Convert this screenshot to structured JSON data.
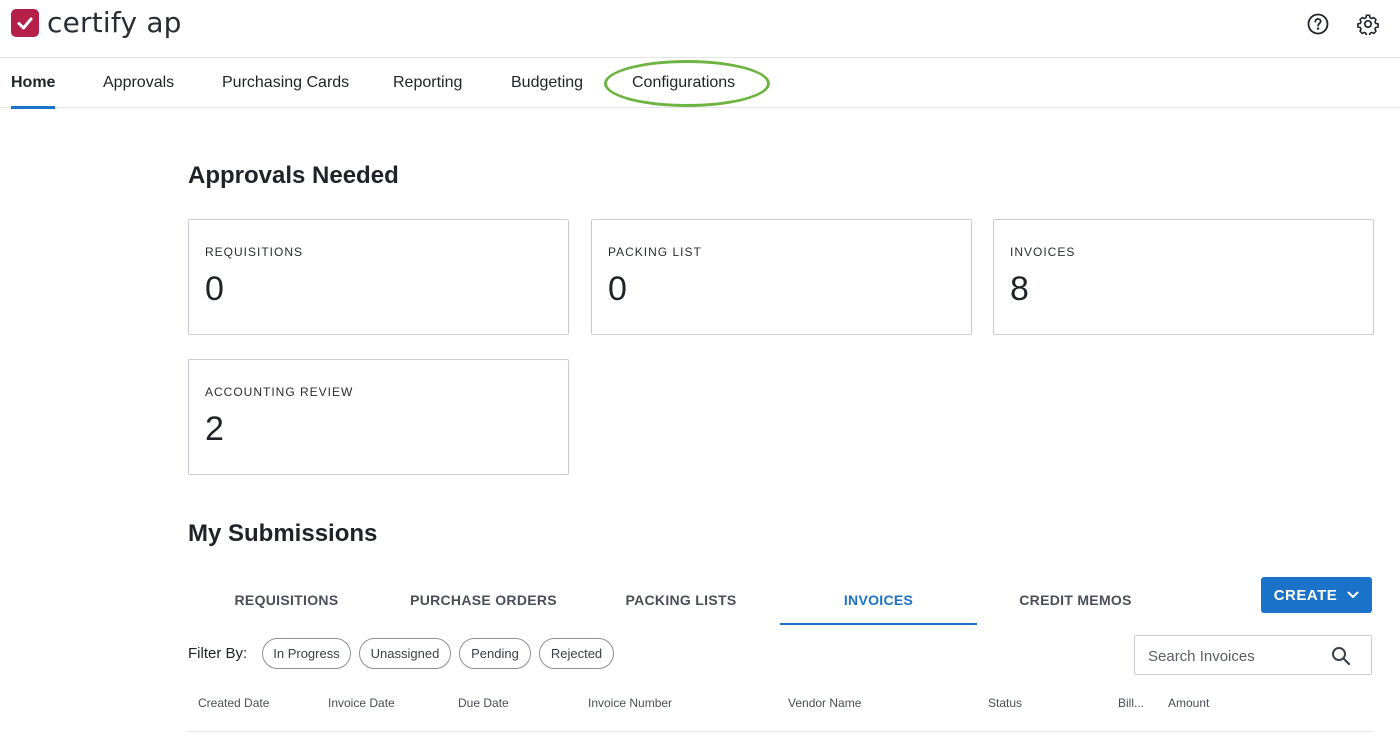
{
  "app": {
    "logo_text": "certify ap"
  },
  "header": {
    "help_icon": "help-circle-icon",
    "settings_icon": "gear-icon"
  },
  "nav": {
    "items": [
      {
        "label": "Home",
        "active": true
      },
      {
        "label": "Approvals"
      },
      {
        "label": "Purchasing Cards"
      },
      {
        "label": "Reporting"
      },
      {
        "label": "Budgeting"
      },
      {
        "label": "Configurations",
        "highlighted": true
      }
    ]
  },
  "approvals": {
    "title": "Approvals Needed",
    "cards": [
      {
        "label": "REQUISITIONS",
        "value": "0"
      },
      {
        "label": "PACKING LIST",
        "value": "0"
      },
      {
        "label": "INVOICES",
        "value": "8"
      },
      {
        "label": "ACCOUNTING REVIEW",
        "value": "2"
      }
    ]
  },
  "submissions": {
    "title": "My Submissions",
    "tabs": [
      {
        "label": "REQUISITIONS"
      },
      {
        "label": "PURCHASE ORDERS"
      },
      {
        "label": "PACKING LISTS"
      },
      {
        "label": "INVOICES",
        "active": true
      },
      {
        "label": "CREDIT MEMOS"
      }
    ],
    "create_label": "CREATE",
    "filter_label": "Filter By:",
    "filters": [
      "In Progress",
      "Unassigned",
      "Pending",
      "Rejected"
    ],
    "search_placeholder": "Search Invoices",
    "columns": [
      "Created Date",
      "Invoice Date",
      "Due Date",
      "Invoice Number",
      "Vendor Name",
      "Status",
      "Bill...",
      "Amount"
    ]
  },
  "colors": {
    "accent": "#1a73c8",
    "brand": "#b5204a",
    "highlight": "#6db33f"
  }
}
